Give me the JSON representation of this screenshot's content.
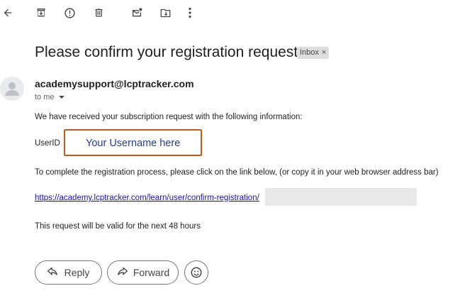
{
  "toolbar": {
    "back": "back-arrow-icon",
    "archive": "archive-icon",
    "report_spam": "report-spam-icon",
    "delete": "trash-icon",
    "mark_unread": "mark-unread-icon",
    "move_to": "move-to-folder-icon",
    "more": "more-vert-icon"
  },
  "message": {
    "subject": "Please confirm your registration request",
    "label": "Inbox",
    "label_remove": "×",
    "sender": "academysupport@lcptracker.com",
    "recipient": "to me"
  },
  "body": {
    "intro": "We have received your subscription request with the following information:",
    "userid_label": "UserID",
    "userid_value": "Your Username here",
    "instructions": "To complete the registration process, please click on the link below, (or copy it in your web browser address bar)",
    "link": "https://academy.lcptracker.com/learn/user/confirm-registration/",
    "validity": "This request will be valid for the next 48 hours"
  },
  "actions": {
    "reply": "Reply",
    "forward": "Forward",
    "emoji": "emoji-reaction-icon"
  },
  "colors": {
    "highlight_border": "#c55a11",
    "userid_text": "#1f3f8f",
    "link": "#1a0dab"
  }
}
